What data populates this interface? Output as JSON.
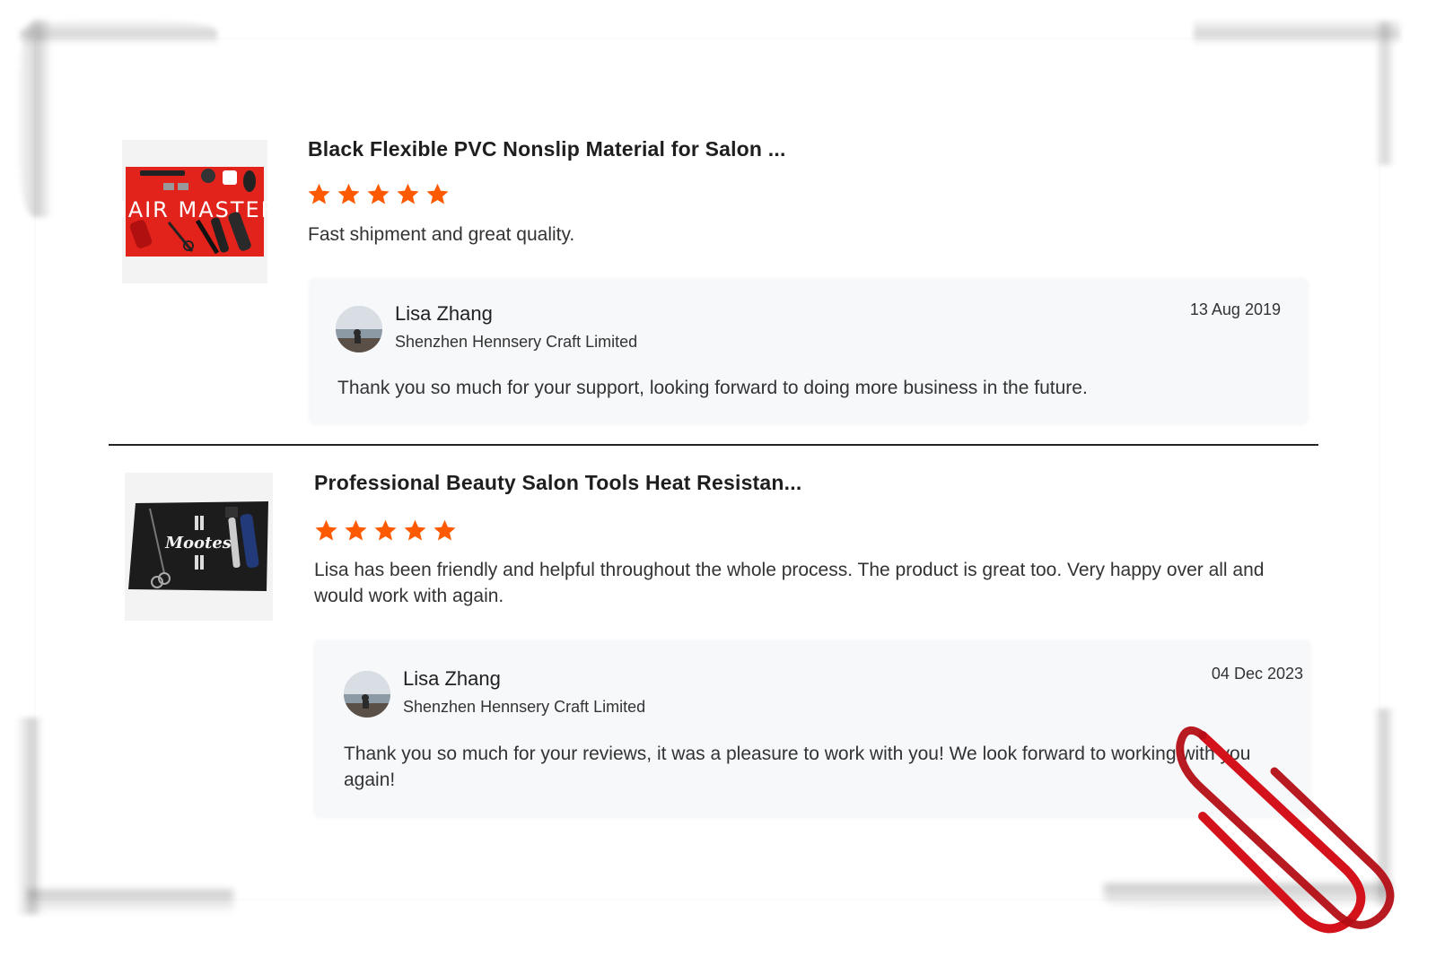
{
  "reviews": [
    {
      "product_title": "Black Flexible PVC Nonslip Material for Salon ...",
      "product_image": "red-hair-master-salon-mat",
      "product_image_text": "HAIR MASTER",
      "rating": 5,
      "review_text": "Fast shipment and great quality.",
      "reply": {
        "seller_name": "Lisa Zhang",
        "company": "Shenzhen Hennsery Craft Limited",
        "date": "13 Aug 2019",
        "text": "Thank you so much for your support, looking forward to doing more business in the future."
      }
    },
    {
      "product_title": "Professional Beauty Salon Tools Heat Resistan...",
      "product_image": "black-mootes-salon-mat",
      "product_image_text": "Mootes",
      "rating": 5,
      "review_text": "Lisa has been friendly and helpful throughout the whole process. The product is great too. Very happy over all and would work with again.",
      "reply": {
        "seller_name": "Lisa Zhang",
        "company": "Shenzhen Hennsery Craft Limited",
        "date": "04 Dec 2023",
        "text": "Thank you so much for your reviews, it was a pleasure to work with you! We look forward to working with you again!"
      }
    }
  ],
  "colors": {
    "star": "#ff5a00",
    "reply_bg": "#f7f8fa",
    "divider": "#222222",
    "paperclip": "#d4121b"
  },
  "icons": {
    "star": "star-icon",
    "paperclip": "paperclip-icon"
  }
}
